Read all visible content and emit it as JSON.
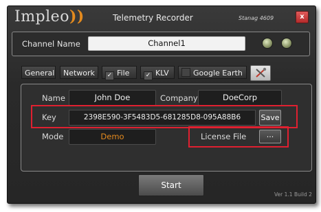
{
  "app": {
    "logo": "Impleo",
    "title": "Telemetry Recorder",
    "stanag": "Stanag 4609",
    "close_label": "x",
    "version": "Ver 1.1 Build 2"
  },
  "channel": {
    "label": "Channel Name",
    "value": "Channel1",
    "indicators": [
      {
        "name": "status-led-1",
        "color": "#a9b27e"
      },
      {
        "name": "status-led-2",
        "color": "#a9b27e"
      }
    ]
  },
  "tabs": [
    {
      "label": "General",
      "checkbox": null
    },
    {
      "label": "Network",
      "checkbox": null
    },
    {
      "label": "File",
      "checkbox": true
    },
    {
      "label": "KLV",
      "checkbox": true
    },
    {
      "label": "Google Earth",
      "checkbox": false
    }
  ],
  "general": {
    "name_label": "Name",
    "name_value": "John Doe",
    "company_label": "Company",
    "company_value": "DoeCorp",
    "key_label": "Key",
    "key_value": "2398E590-3F5483D5-681285D8-095A88B6",
    "save_label": "Save",
    "mode_label": "Mode",
    "mode_value": "Demo",
    "license_label": "License File",
    "browse_label": "..."
  },
  "start_label": "Start",
  "colors": {
    "accent": "#e38a1e",
    "highlight_border": "#e02030",
    "close_red": "#c0392b"
  }
}
